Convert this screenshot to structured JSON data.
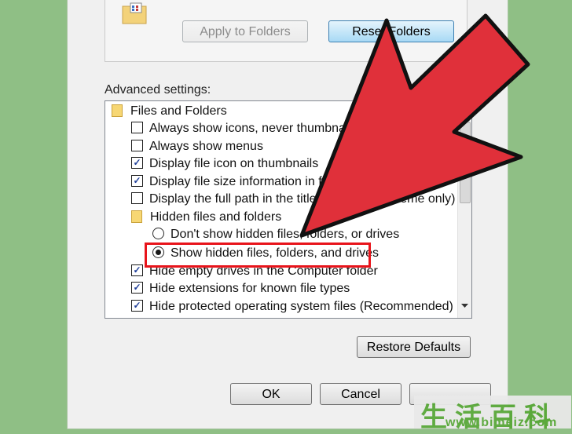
{
  "top": {
    "apply_label": "Apply to Folders",
    "reset_label": "Reset Folders"
  },
  "advanced_label": "Advanced settings:",
  "list": {
    "folder_header": "Files and Folders",
    "items": [
      {
        "label": "Always show icons, never thumbnails",
        "checked": false
      },
      {
        "label": "Always show menus",
        "checked": false
      },
      {
        "label": "Display file icon on thumbnails",
        "checked": true
      },
      {
        "label": "Display file size information in folder tips",
        "checked": true
      },
      {
        "label": "Display the full path in the title bar (Classic theme only)",
        "checked": false
      }
    ],
    "hidden_group": "Hidden files and folders",
    "radios": [
      {
        "label": "Don't show hidden files, folders, or drives",
        "selected": false
      },
      {
        "label": "Show hidden files, folders, and drives",
        "selected": true
      }
    ],
    "items2": [
      {
        "label": "Hide empty drives in the Computer folder",
        "checked": true
      },
      {
        "label": "Hide extensions for known file types",
        "checked": true
      },
      {
        "label": "Hide protected operating system files (Recommended)",
        "checked": true
      }
    ]
  },
  "buttons": {
    "restore": "Restore Defaults",
    "ok": "OK",
    "cancel": "Cancel"
  },
  "watermark": {
    "chars": "生活百科",
    "url": "www.bimeiz.com"
  },
  "colors": {
    "arrow": "#e0303a",
    "highlight": "#e8141b",
    "background": "#8fbf85"
  }
}
